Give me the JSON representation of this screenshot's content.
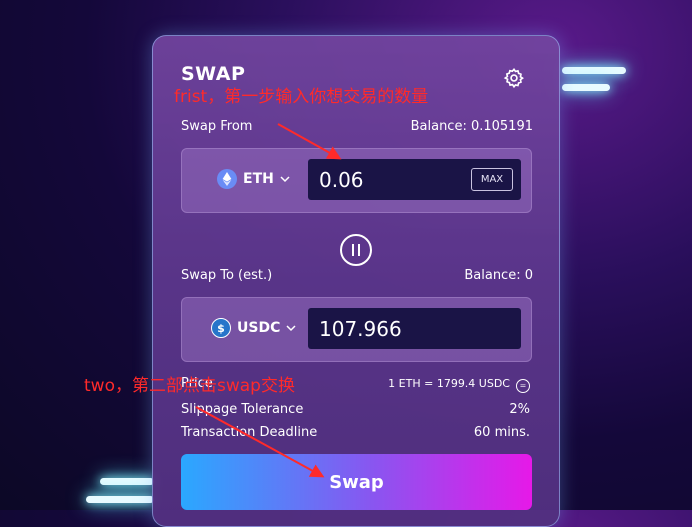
{
  "swap": {
    "title": "SWAP",
    "from_label": "Swap From",
    "from_balance": "Balance: 0.105191",
    "from_token": "ETH",
    "from_amount": "0.06",
    "max_label": "MAX",
    "to_label": "Swap To (est.)",
    "to_balance": "Balance: 0",
    "to_token": "USDC",
    "to_amount": "107.966",
    "price_label": "Price",
    "price_value": "1 ETH = 1799.4 USDC",
    "slippage_label": "Slippage Tolerance",
    "slippage_value": "2%",
    "deadline_label": "Transaction Deadline",
    "deadline_value": "60 mins.",
    "swap_button": "Swap"
  },
  "annotations": {
    "first": "frist，第一步输入你想交易的数量",
    "second": "two，第二部点击swap交换"
  },
  "colors": {
    "annotation": "#ff2a2a",
    "eth_icon": "#6a8cf5",
    "usdc_icon": "#2775ca",
    "button_start": "#2aa8ff",
    "button_end": "#e619e8"
  }
}
